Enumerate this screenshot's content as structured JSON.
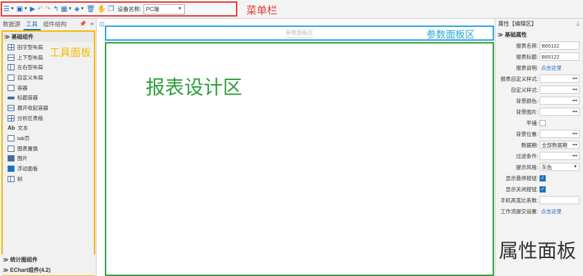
{
  "toolbar": {
    "device_label": "设备名称:",
    "device_value": "PC端",
    "annotation": "菜单栏"
  },
  "left_panel": {
    "tabs": [
      "数据源",
      "工具",
      "组件结构"
    ],
    "active_tab": "工具",
    "sections": {
      "basic": "基础组件",
      "stats": "统计图组件",
      "echart": "EChart组件(4.2)"
    },
    "items": [
      {
        "label": "田字型布局",
        "icon": "grid-layout-icon"
      },
      {
        "label": "上下型布局",
        "icon": "vertical-layout-icon"
      },
      {
        "label": "左右型布局",
        "icon": "horizontal-layout-icon"
      },
      {
        "label": "自定义布局",
        "icon": "custom-layout-icon"
      },
      {
        "label": "容器",
        "icon": "container-icon"
      },
      {
        "label": "标题容器",
        "icon": "title-container-icon"
      },
      {
        "label": "展开收起容器",
        "icon": "expand-container-icon"
      },
      {
        "label": "分析区表格",
        "icon": "table-icon"
      },
      {
        "label": "文本",
        "icon": "text-icon"
      },
      {
        "label": "tab页",
        "icon": "tab-icon"
      },
      {
        "label": "图表置换",
        "icon": "chart-swap-icon"
      },
      {
        "label": "图片",
        "icon": "image-icon"
      },
      {
        "label": "浮动面板",
        "icon": "float-panel-icon"
      },
      {
        "label": "树",
        "icon": "tree-icon"
      }
    ],
    "annotation": "工具面板"
  },
  "center": {
    "param_placeholder": "参数面板区",
    "param_annotation": "参数面板区",
    "design_annotation": "报表设计区"
  },
  "right_panel": {
    "title": "属性【编辑区】",
    "section": "基础属性",
    "rows": [
      {
        "label": "报表名称:",
        "type": "text",
        "value": "B65122"
      },
      {
        "label": "报表标题:",
        "type": "text",
        "value": "B65122"
      },
      {
        "label": "报表说明:",
        "type": "link",
        "value": "点击这里"
      },
      {
        "label": "报表自定义样式:",
        "type": "dots",
        "value": ""
      },
      {
        "label": "自定义样式:",
        "type": "dots",
        "value": ""
      },
      {
        "label": "背景颜色:",
        "type": "dots",
        "value": ""
      },
      {
        "label": "背景图片:",
        "type": "dots",
        "value": ""
      },
      {
        "label": "平铺:",
        "type": "check",
        "checked": false
      },
      {
        "label": "背景位置:",
        "type": "dots",
        "value": ""
      },
      {
        "label": "数据期:",
        "type": "dots",
        "value": "全部数据期"
      },
      {
        "label": "过滤条件:",
        "type": "dots",
        "value": ""
      },
      {
        "label": "提示风格:",
        "type": "select",
        "value": "灰色"
      },
      {
        "label": "显示悬停按钮:",
        "type": "check",
        "checked": true
      },
      {
        "label": "显示关闭按钮:",
        "type": "check",
        "checked": true
      },
      {
        "label": "手机高宽比系数:",
        "type": "text",
        "value": ""
      },
      {
        "label": "工作流提交设置:",
        "type": "link",
        "value": "点击这里"
      }
    ],
    "annotation": "属性面板"
  },
  "colors": {
    "menu_annotation": "#e53935",
    "tool_annotation": "#f5b800",
    "param_annotation": "#29a4d8",
    "design_annotation": "#2e9e3c",
    "accent": "#1e6fc4"
  }
}
